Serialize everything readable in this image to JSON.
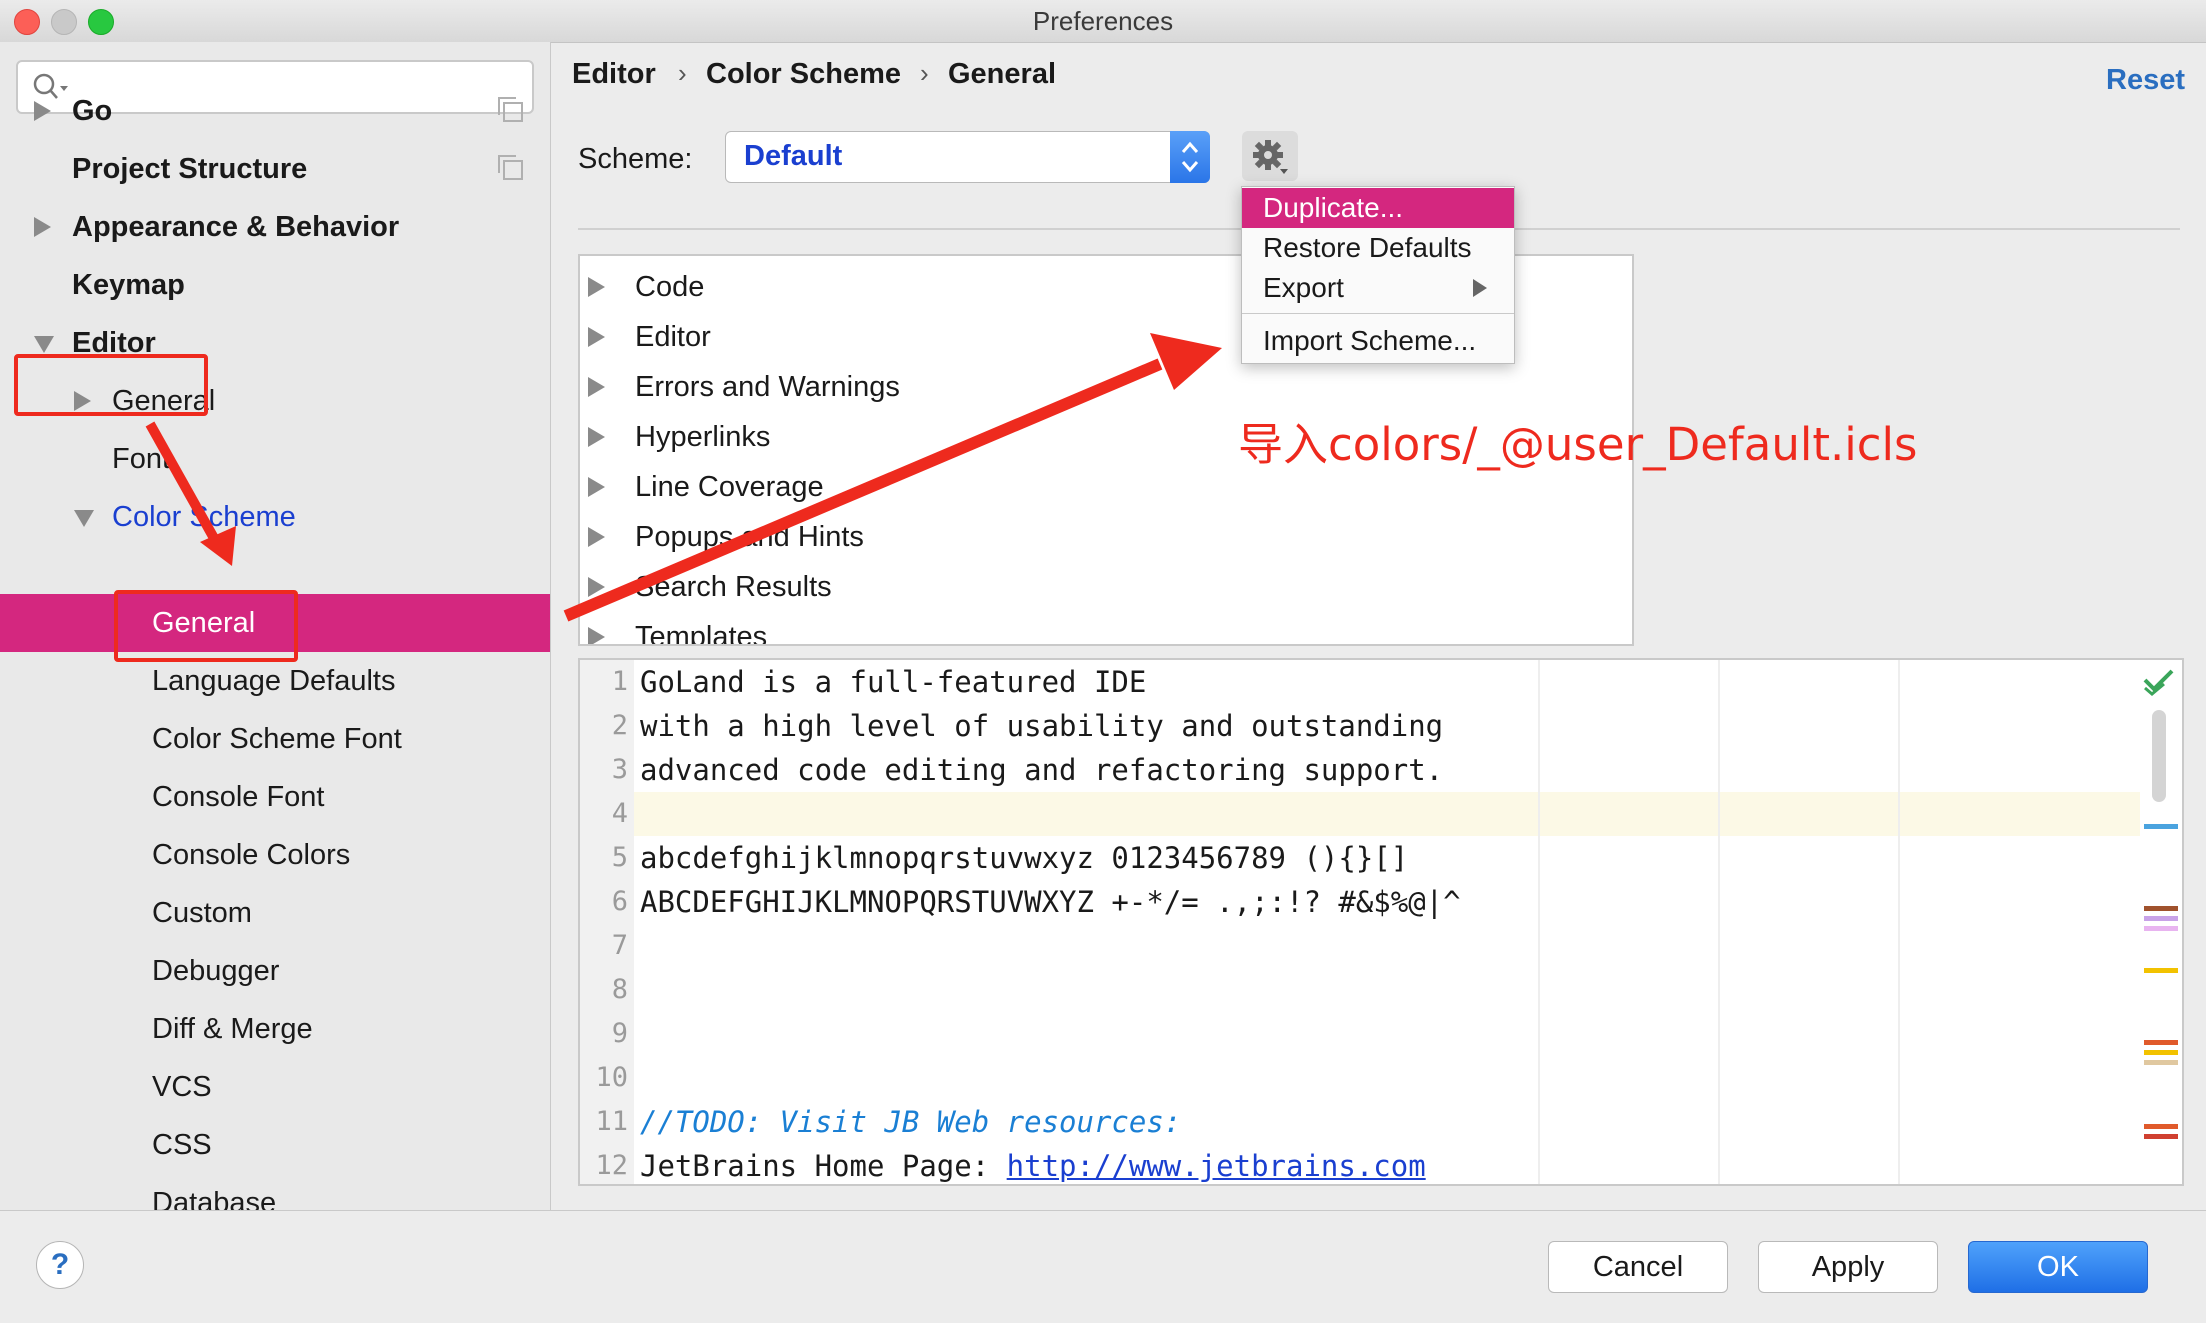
{
  "window": {
    "title": "Preferences",
    "traffic_lights": {
      "close_color": "#fc5f57",
      "minimize_color": "#fdbc2e",
      "maximize_color": "#28c840"
    }
  },
  "sidebar": {
    "search_placeholder": "",
    "items": [
      {
        "label": "Go"
      },
      {
        "label": "Project Structure"
      },
      {
        "label": "Appearance & Behavior"
      },
      {
        "label": "Keymap"
      },
      {
        "label": "Editor"
      },
      {
        "label": "General"
      },
      {
        "label": "Font"
      },
      {
        "label": "Color Scheme"
      },
      {
        "label": "General"
      },
      {
        "label": "Language Defaults"
      },
      {
        "label": "Color Scheme Font"
      },
      {
        "label": "Console Font"
      },
      {
        "label": "Console Colors"
      },
      {
        "label": "Custom"
      },
      {
        "label": "Debugger"
      },
      {
        "label": "Diff & Merge"
      },
      {
        "label": "VCS"
      },
      {
        "label": "CSS"
      },
      {
        "label": "Database"
      }
    ],
    "selected_color": "#d4277f",
    "link_color": "#1a3fd0"
  },
  "breadcrumb": [
    "Editor",
    "Color Scheme",
    "General"
  ],
  "breadcrumb_separator": "›",
  "reset_label": "Reset",
  "scheme": {
    "label": "Scheme:",
    "value": "Default",
    "arrow": "⌃⌄"
  },
  "tree_items": [
    "Code",
    "Editor",
    "Errors and Warnings",
    "Hyperlinks",
    "Line Coverage",
    "Popups and Hints",
    "Search Results",
    "Templates"
  ],
  "gear_menu": {
    "items": [
      "Duplicate...",
      "Restore Defaults",
      "Export",
      "Import Scheme..."
    ],
    "highlighted": "Duplicate..."
  },
  "annotation": "导入colors/_@user_Default.icls",
  "preview": {
    "line_numbers": [
      "1",
      "2",
      "3",
      "4",
      "5",
      "6",
      "7",
      "8",
      "9",
      "10",
      "11",
      "12"
    ],
    "lines": [
      "GoLand is a full-featured IDE",
      "with a high level of usability and outstanding",
      "advanced code editing and refactoring support.",
      "",
      "abcdefghijklmnopqrstuvwxyz 0123456789 (){}[]",
      "ABCDEFGHIJKLMNOPQRSTUVWXYZ +-*/= .,;:!? #&$%@|^",
      "",
      "",
      "",
      "",
      "//TODO: Visit JB Web resources:",
      "JetBrains Home Page: "
    ],
    "link_text": "http://www.jetbrains.com",
    "marker_colors": [
      "#4aa3df",
      "#a0522d",
      "#c8a2e8",
      "#e8b4f0",
      "#f2c200",
      "#e05a2b",
      "#f2c200",
      "#e0c8a0",
      "#e05a2b",
      "#d04030"
    ],
    "status_icon": "check-icon"
  },
  "buttons": {
    "help": "?",
    "cancel": "Cancel",
    "apply": "Apply",
    "ok": "OK"
  }
}
